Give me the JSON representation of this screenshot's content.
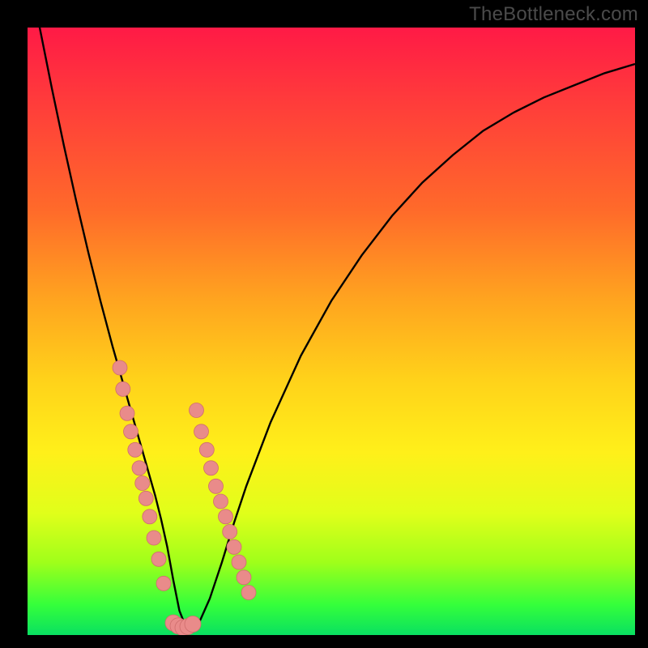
{
  "watermark": "TheBottleneck.com",
  "colors": {
    "curve": "#000000",
    "marker_fill": "#e98b8a",
    "marker_stroke": "#cf6e6d",
    "background_black": "#000000"
  },
  "chart_data": {
    "type": "line",
    "title": "",
    "xlabel": "",
    "ylabel": "",
    "xlim": [
      0,
      100
    ],
    "ylim": [
      0,
      100
    ],
    "grid": false,
    "legend": false,
    "x": [
      0,
      2,
      4,
      6,
      8,
      10,
      12,
      14,
      16,
      18,
      19,
      20,
      21,
      22,
      23,
      24,
      25,
      26,
      27,
      28,
      30,
      32,
      34,
      36,
      40,
      45,
      50,
      55,
      60,
      65,
      70,
      75,
      80,
      85,
      90,
      95,
      100
    ],
    "y": [
      110,
      100,
      90,
      80.5,
      71.5,
      63,
      55,
      47.5,
      40.5,
      33.5,
      30,
      26.5,
      23,
      19,
      14.5,
      9,
      4,
      1.5,
      1,
      1.5,
      6,
      12,
      18.5,
      24.5,
      35,
      46,
      55,
      62.5,
      69,
      74.5,
      79,
      83,
      86,
      88.5,
      90.5,
      92.5,
      94
    ],
    "markers_left": {
      "x": [
        15.2,
        15.7,
        16.4,
        17.0,
        17.7,
        18.4,
        18.9,
        19.5,
        20.1,
        20.8,
        21.6,
        22.4
      ],
      "y": [
        44.0,
        40.5,
        36.5,
        33.5,
        30.5,
        27.5,
        25.0,
        22.5,
        19.5,
        16.0,
        12.5,
        8.5
      ]
    },
    "markers_right": {
      "x": [
        27.8,
        28.6,
        29.5,
        30.2,
        31.0,
        31.8,
        32.6,
        33.3,
        34.0,
        34.8,
        35.6,
        36.4
      ],
      "y": [
        37.0,
        33.5,
        30.5,
        27.5,
        24.5,
        22.0,
        19.5,
        17.0,
        14.5,
        12.0,
        9.5,
        7.0
      ]
    },
    "markers_bottom": {
      "x": [
        24.0,
        24.8,
        25.6,
        26.4,
        27.2
      ],
      "y": [
        2.0,
        1.5,
        1.2,
        1.4,
        1.8
      ]
    }
  }
}
